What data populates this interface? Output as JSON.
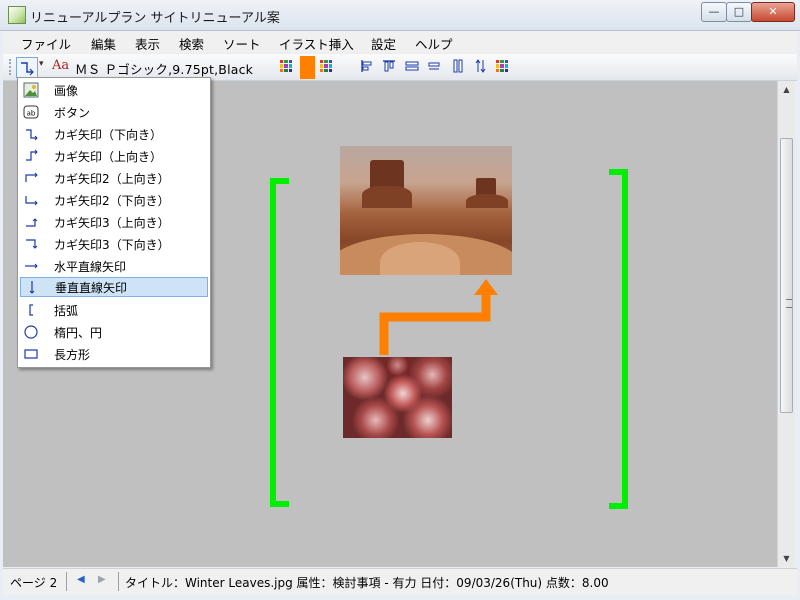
{
  "window": {
    "title": "リニューアルプラン  サイトリニューアル案"
  },
  "title_buttons": {
    "minimize": "—",
    "maximize": "□",
    "close": "✕"
  },
  "menubar": {
    "items": [
      "ファイル",
      "編集",
      "表示",
      "検索",
      "ソート",
      "イラスト挿入",
      "設定",
      "ヘルプ"
    ]
  },
  "toolbar": {
    "font_label": "ＭＳ Ｐゴシック,9.75pt,Black",
    "font_icon_text": "Aa",
    "dropdown_arrow": "▾",
    "accent_color": "#ff7f00"
  },
  "dropdown": {
    "items": [
      {
        "label": "画像",
        "icon": "image-icon"
      },
      {
        "label": "ボタン",
        "icon": "button-icon"
      },
      {
        "label": "カギ矢印（下向き）",
        "icon": "elbow-arrow-down-icon"
      },
      {
        "label": "カギ矢印（上向き）",
        "icon": "elbow-arrow-up-icon"
      },
      {
        "label": "カギ矢印2（上向き）",
        "icon": "elbow-arrow2-up-icon"
      },
      {
        "label": "カギ矢印2（下向き）",
        "icon": "elbow-arrow2-down-icon"
      },
      {
        "label": "カギ矢印3（上向き）",
        "icon": "elbow-arrow3-up-icon"
      },
      {
        "label": "カギ矢印3（下向き）",
        "icon": "elbow-arrow3-down-icon"
      },
      {
        "label": "水平直線矢印",
        "icon": "horizontal-arrow-icon"
      },
      {
        "label": "垂直直線矢印",
        "icon": "vertical-arrow-icon"
      },
      {
        "label": "括弧",
        "icon": "bracket-icon"
      },
      {
        "label": "楕円、円",
        "icon": "ellipse-icon"
      },
      {
        "label": "長方形",
        "icon": "rectangle-icon"
      }
    ],
    "selected": "垂直直線矢印"
  },
  "canvas": {
    "background": "#c0c0c0",
    "bracket_color": "#00ee00",
    "arrow_color": "#ff7f00"
  },
  "statusbar": {
    "page": "ページ 2",
    "info": "タイトル：Winter Leaves.jpg  属性：検討事項 - 有力  日付：09/03/26(Thu)  点数：8.00"
  }
}
